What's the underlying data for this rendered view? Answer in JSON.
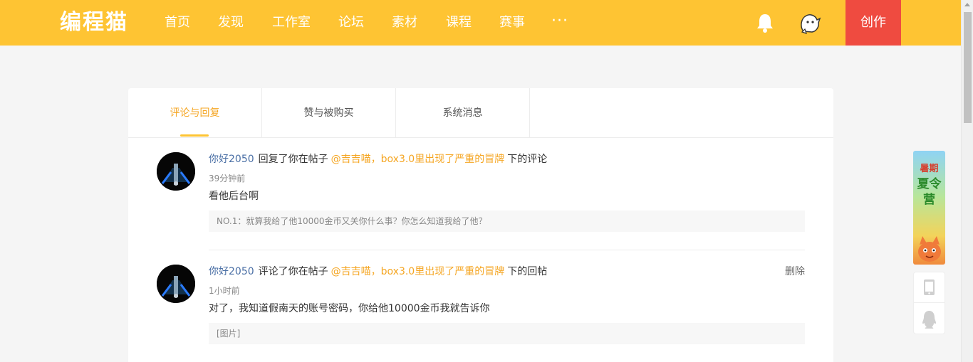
{
  "header": {
    "logo": "编程猫",
    "nav": [
      "首页",
      "发现",
      "工作室",
      "论坛",
      "素材",
      "课程",
      "赛事"
    ],
    "more": "···",
    "create": "创作"
  },
  "tabs": [
    {
      "label": "评论与回复",
      "active": true
    },
    {
      "label": "赞与被购买",
      "active": false
    },
    {
      "label": "系统消息",
      "active": false
    }
  ],
  "messages": [
    {
      "user": "你好2050",
      "action": "回复了你在帖子",
      "post": "@吉吉喵，box3.0里出现了严重的冒牌",
      "tail": "下的评论",
      "time": "39分钟前",
      "content": "看他后台啊",
      "quote": "NO.1：就算我给了他10000金币又关你什么事？你怎么知道我给了他？"
    },
    {
      "user": "你好2050",
      "action": "评论了你在帖子",
      "post": "@吉吉喵，box3.0里出现了严重的冒牌",
      "tail": "下的回帖",
      "time": "1小时前",
      "content": "对了，我知道假南天的账号密码，你给他10000金币我就告诉你",
      "quote": "[图片]",
      "delete": "删除"
    }
  ],
  "promo": {
    "line1": "暑期",
    "line2": "夏令营"
  },
  "colors": {
    "brand": "#fec433",
    "create": "#ef4b40",
    "accent": "#f5a623",
    "username": "#4a6fa5"
  }
}
